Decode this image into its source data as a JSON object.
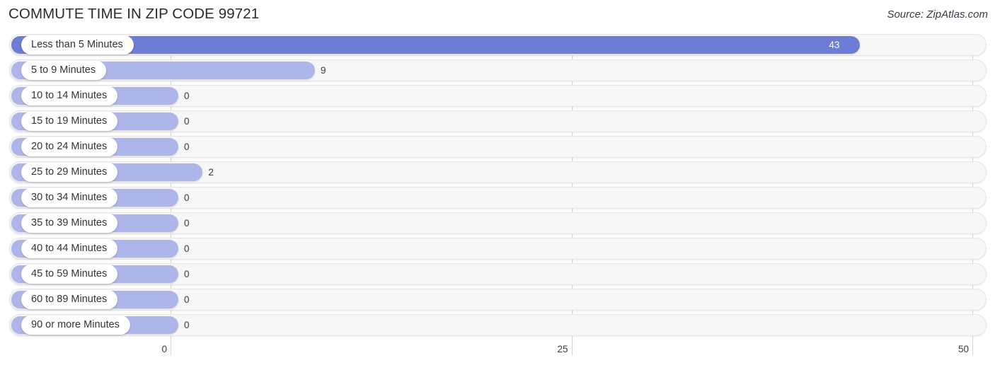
{
  "header": {
    "title": "COMMUTE TIME IN ZIP CODE 99721",
    "source": "Source: ZipAtlas.com"
  },
  "colors": {
    "bar_light": "#aeb5e8",
    "bar_dark": "#6d7cd4",
    "track": "#f7f7f8",
    "gridline": "#d3d3d8",
    "text": "#33333b"
  },
  "chart_data": {
    "type": "bar",
    "orientation": "horizontal",
    "title": "COMMUTE TIME IN ZIP CODE 99721",
    "subtitle": "Source: ZipAtlas.com",
    "xlabel": "",
    "ylabel": "",
    "xlim": [
      0,
      50
    ],
    "grid": true,
    "legend": "none",
    "axis_ticks": [
      "0",
      "25",
      "50"
    ],
    "axis_tick_values": [
      0,
      25,
      50
    ],
    "categories": [
      "Less than 5 Minutes",
      "5 to 9 Minutes",
      "10 to 14 Minutes",
      "15 to 19 Minutes",
      "20 to 24 Minutes",
      "25 to 29 Minutes",
      "30 to 34 Minutes",
      "35 to 39 Minutes",
      "40 to 44 Minutes",
      "45 to 59 Minutes",
      "60 to 89 Minutes",
      "90 or more Minutes"
    ],
    "values": [
      43,
      9,
      0,
      0,
      0,
      2,
      0,
      0,
      0,
      0,
      0,
      0
    ],
    "value_labels": [
      "43",
      "9",
      "0",
      "0",
      "0",
      "2",
      "0",
      "0",
      "0",
      "0",
      "0",
      "0"
    ],
    "bars": [
      {
        "label": "Less than 5 Minutes",
        "value": 43,
        "value_label": "43",
        "shade": "dark",
        "label_position": "inside"
      },
      {
        "label": "5 to 9 Minutes",
        "value": 9,
        "value_label": "9",
        "shade": "light",
        "label_position": "outside"
      },
      {
        "label": "10 to 14 Minutes",
        "value": 0,
        "value_label": "0",
        "shade": "light",
        "label_position": "outside"
      },
      {
        "label": "15 to 19 Minutes",
        "value": 0,
        "value_label": "0",
        "shade": "light",
        "label_position": "outside"
      },
      {
        "label": "20 to 24 Minutes",
        "value": 0,
        "value_label": "0",
        "shade": "light",
        "label_position": "outside"
      },
      {
        "label": "25 to 29 Minutes",
        "value": 2,
        "value_label": "2",
        "shade": "light",
        "label_position": "outside"
      },
      {
        "label": "30 to 34 Minutes",
        "value": 0,
        "value_label": "0",
        "shade": "light",
        "label_position": "outside"
      },
      {
        "label": "35 to 39 Minutes",
        "value": 0,
        "value_label": "0",
        "shade": "light",
        "label_position": "outside"
      },
      {
        "label": "40 to 44 Minutes",
        "value": 0,
        "value_label": "0",
        "shade": "light",
        "label_position": "outside"
      },
      {
        "label": "45 to 59 Minutes",
        "value": 0,
        "value_label": "0",
        "shade": "light",
        "label_position": "outside"
      },
      {
        "label": "60 to 89 Minutes",
        "value": 0,
        "value_label": "0",
        "shade": "light",
        "label_position": "outside"
      },
      {
        "label": "90 or more Minutes",
        "value": 0,
        "value_label": "0",
        "shade": "light",
        "label_position": "outside"
      }
    ]
  }
}
